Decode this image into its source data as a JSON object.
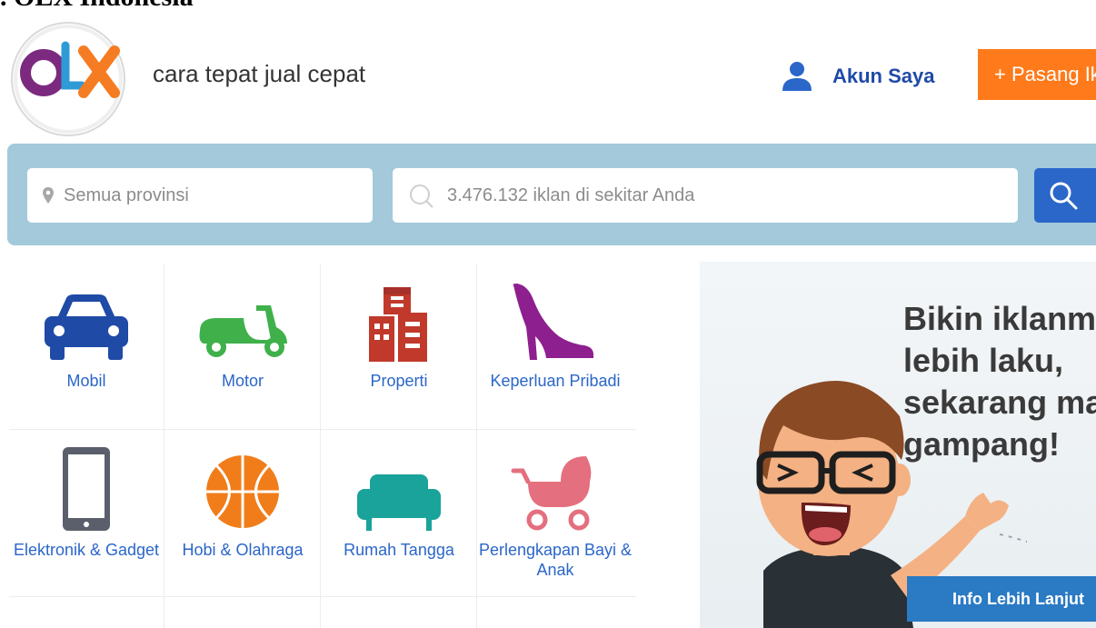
{
  "caption": ". OLX Indonesia",
  "header": {
    "logo_alt": "OLX",
    "tagline": "cara tepat jual cepat",
    "account_label": "Akun Saya",
    "post_label": "+ Pasang Iklan"
  },
  "search": {
    "province_placeholder": "Semua provinsi",
    "query_placeholder": "3.476.132 iklan di sekitar Anda"
  },
  "categories": [
    {
      "label": "Mobil",
      "icon": "car-icon",
      "color": "#1f4aa6"
    },
    {
      "label": "Motor",
      "icon": "scooter-icon",
      "color": "#3fb04a"
    },
    {
      "label": "Properti",
      "icon": "building-icon",
      "color": "#c0392b"
    },
    {
      "label": "Keperluan Pribadi",
      "icon": "high-heel-icon",
      "color": "#8e1f8f"
    },
    {
      "label": "Elektronik & Gadget",
      "icon": "phone-icon",
      "color": "#5a5f6b"
    },
    {
      "label": "Hobi & Olahraga",
      "icon": "basketball-icon",
      "color": "#f07d1a"
    },
    {
      "label": "Rumah Tangga",
      "icon": "sofa-icon",
      "color": "#1aa39a"
    },
    {
      "label": "Perlengkapan Bayi & Anak",
      "icon": "stroller-icon",
      "color": "#e46f7e"
    }
  ],
  "banner": {
    "title_lines": [
      "Bikin iklanmu",
      "lebih laku,",
      "sekarang makin",
      "gampang!"
    ],
    "button_label": "Info Lebih Lanjut"
  },
  "colors": {
    "brand_orange": "#ff7a1a",
    "link_blue": "#2b66c9",
    "search_band": "#a3c9db"
  }
}
